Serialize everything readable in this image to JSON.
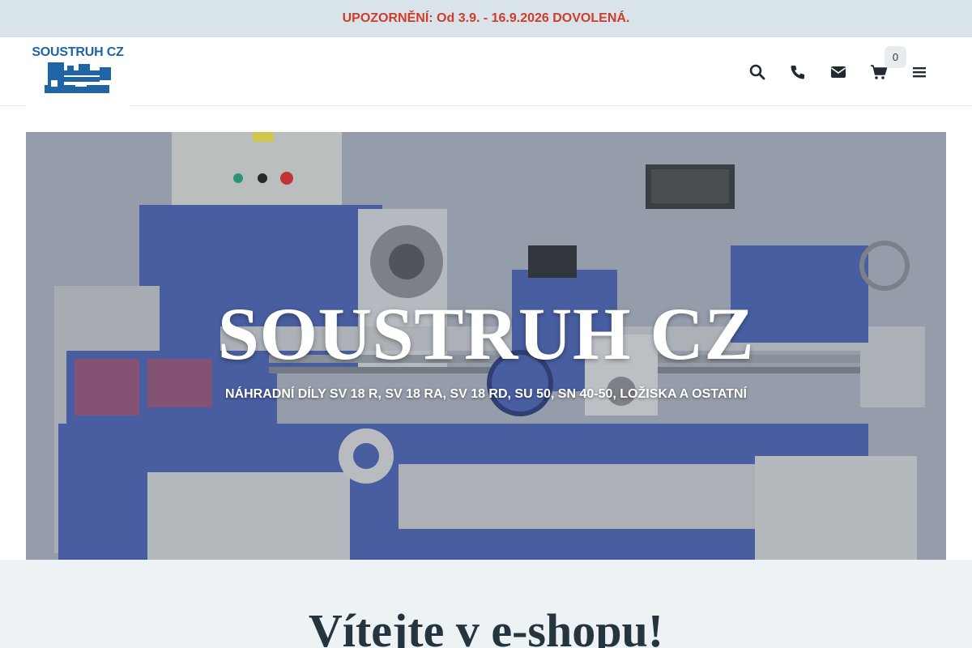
{
  "notice": {
    "text": "UPOZORNĚNÍ: Od 3.9. - 16.9.2026 DOVOLENÁ."
  },
  "logo": {
    "text": "SOUSTRUH CZ",
    "mark_icon": "lathe-icon"
  },
  "header": {
    "icons": [
      "search-icon",
      "phone-icon",
      "envelope-icon",
      "cart-icon",
      "menu-icon"
    ],
    "cart_count": "0"
  },
  "hero": {
    "title": "SOUSTRUH CZ",
    "subtitle": "NÁHRADNÍ DÍLY SV 18 R, SV 18 RA, SV 18 RD, SU 50, SN 40-50, LOŽISKA A OSTATNÍ"
  },
  "welcome": {
    "title": "Vítejte v e-shopu!"
  },
  "colors": {
    "notice_bg": "#d9e4ea",
    "notice_text": "#d23a2a",
    "brand": "#1e64a6",
    "welcome_bg": "#edf2f4",
    "heading": "#25353f"
  }
}
